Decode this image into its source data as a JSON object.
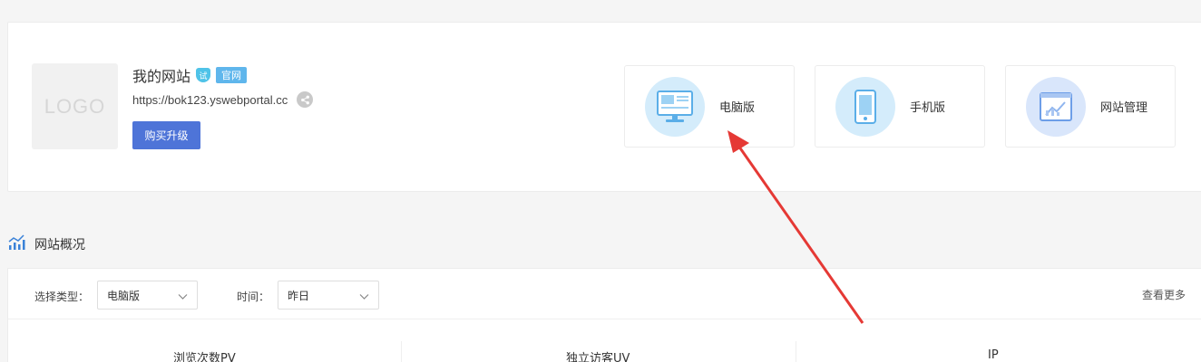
{
  "site": {
    "logo_text": "LOGO",
    "name": "我的网站",
    "trial_badge": "试",
    "official_badge": "官网",
    "url": "https://bok123.yswebportal.cc",
    "buy_button": "购买升级"
  },
  "entries": [
    {
      "label": "电脑版",
      "icon": "desktop-icon"
    },
    {
      "label": "手机版",
      "icon": "mobile-icon"
    },
    {
      "label": "网站管理",
      "icon": "site-manage-icon"
    }
  ],
  "overview": {
    "title": "网站概况",
    "type_label": "选择类型：",
    "type_value": "电脑版",
    "time_label": "时间：",
    "time_value": "昨日",
    "more_link": "查看更多",
    "metrics": [
      "浏览次数PV",
      "独立访客UV",
      "IP"
    ]
  },
  "colors": {
    "primary": "#4e74d8",
    "annotation_arrow": "#e53935",
    "badge_blue": "#5fb6ec"
  }
}
